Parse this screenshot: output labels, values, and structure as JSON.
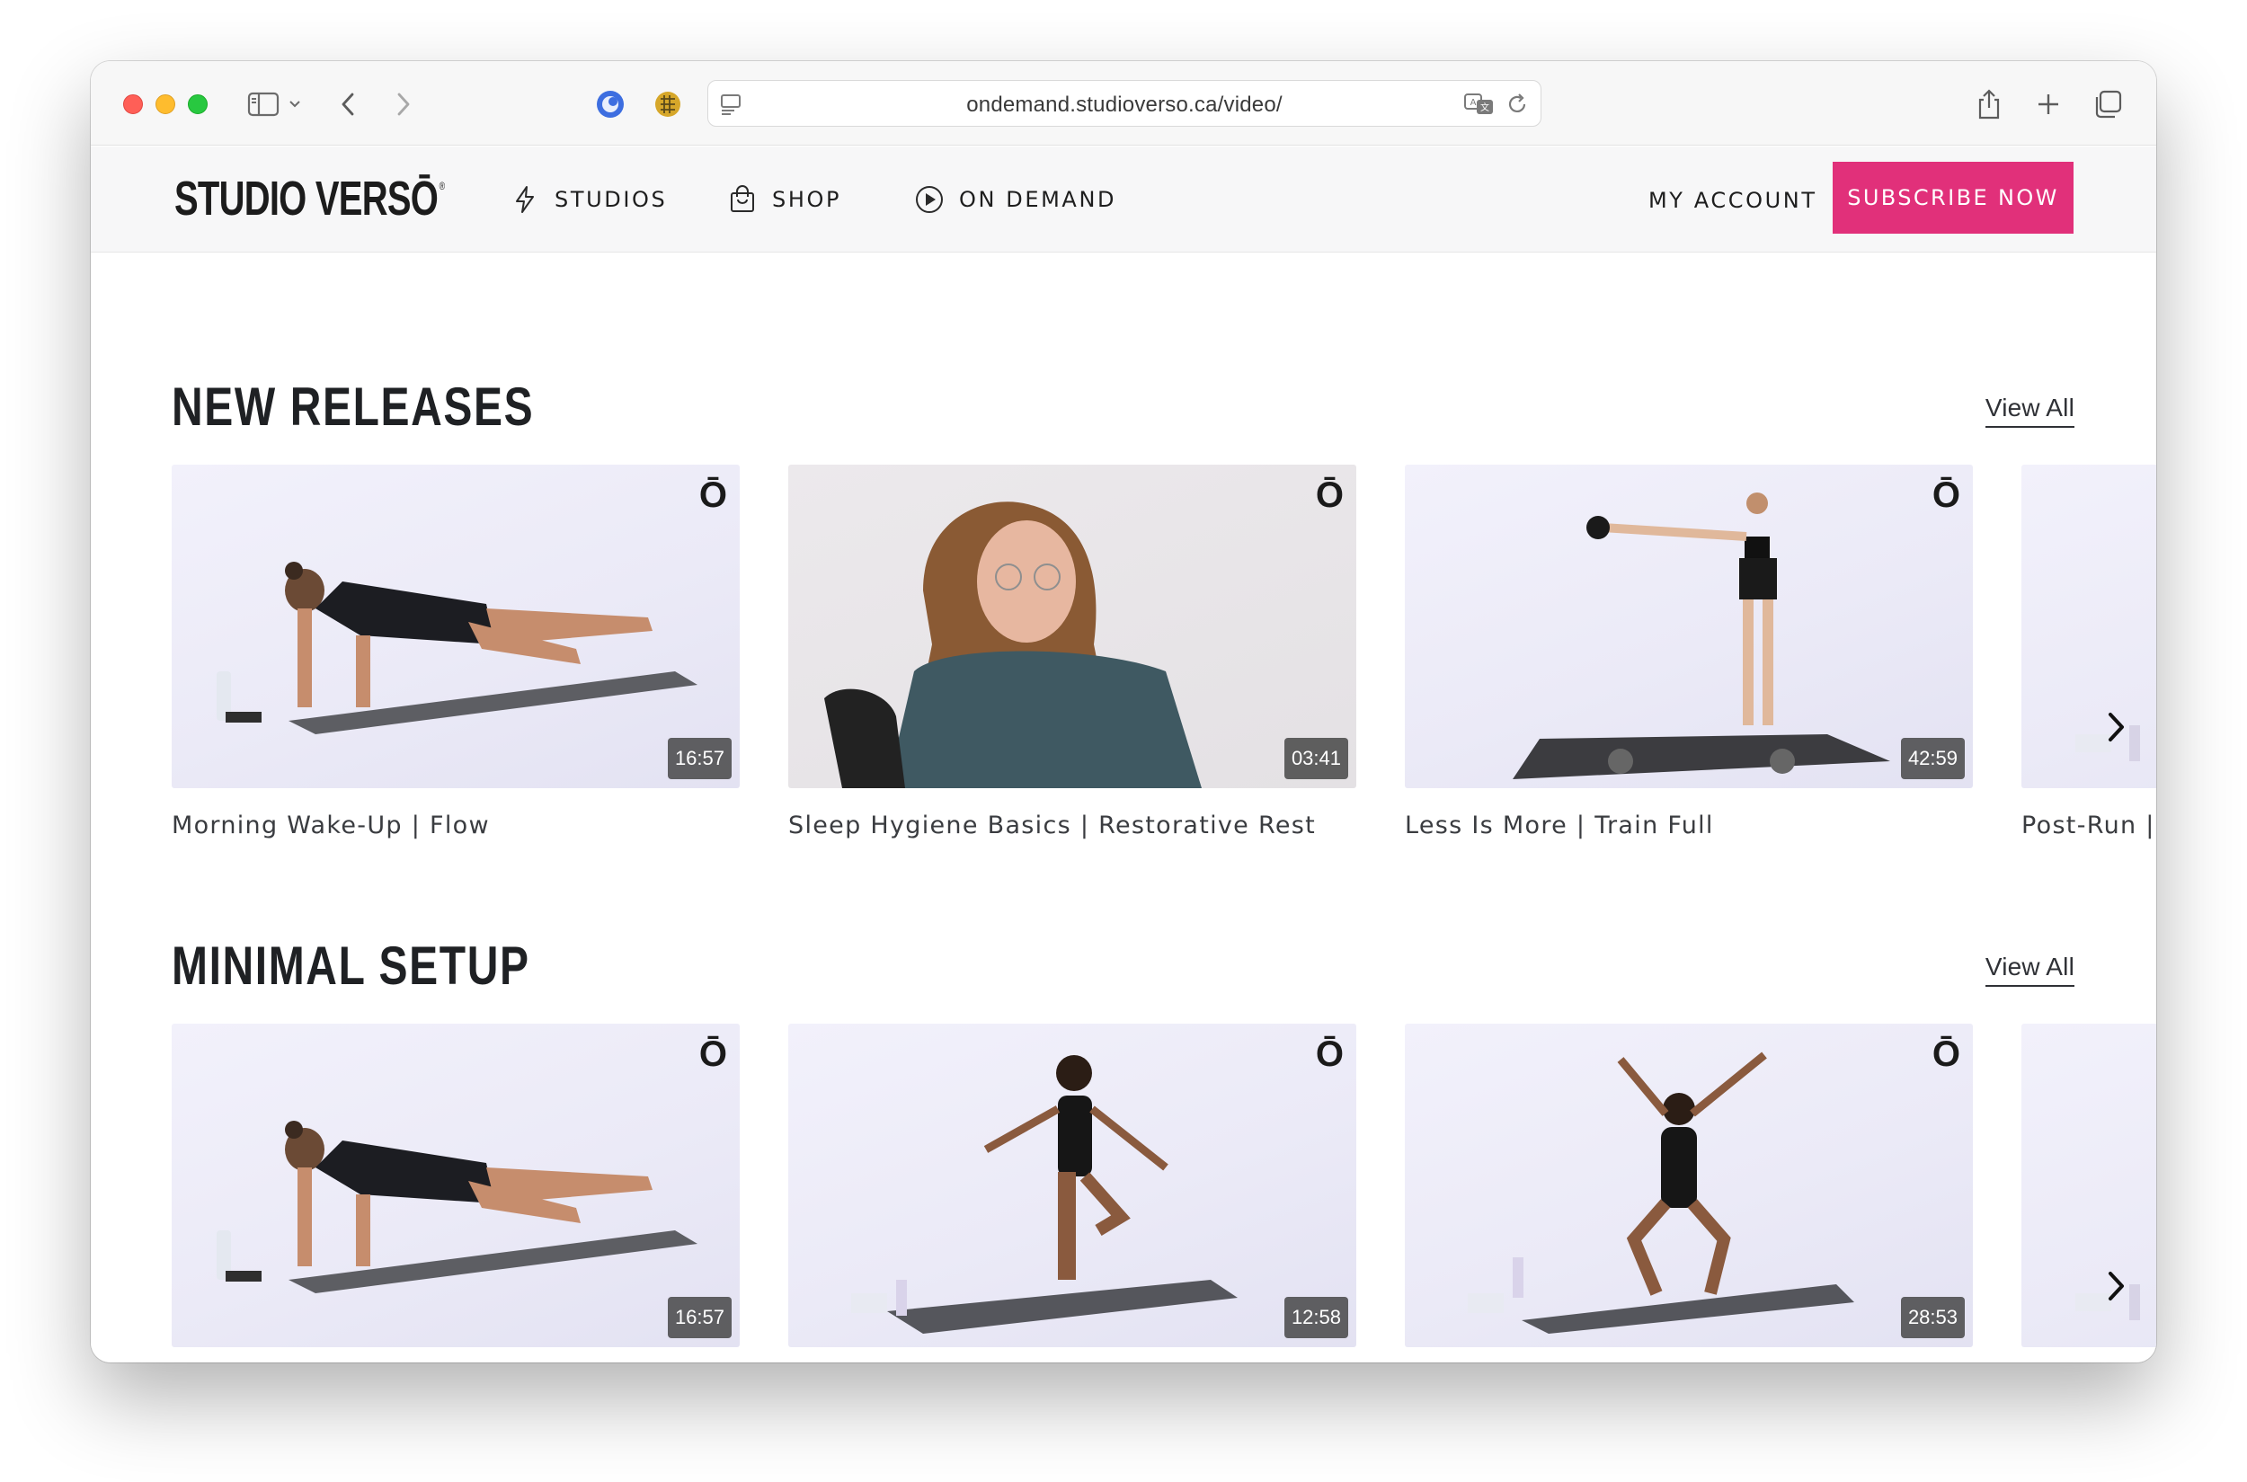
{
  "browser": {
    "url": "ondemand.studioverso.ca/video/"
  },
  "site": {
    "logo": "STUDIO VERSŌ",
    "logo_mark": "®",
    "nav": [
      {
        "label": "STUDIOS",
        "icon": "lightning-icon"
      },
      {
        "label": "SHOP",
        "icon": "shopping-bag-icon"
      },
      {
        "label": "ON DEMAND",
        "icon": "play-circle-icon"
      }
    ],
    "account_label": "MY ACCOUNT",
    "subscribe_label": "SUBSCRIBE NOW",
    "accent_color": "#e1307a"
  },
  "sections": [
    {
      "title": "NEW RELEASES",
      "view_all": "View All",
      "videos": [
        {
          "title": "Morning Wake-Up | Flow",
          "duration": "16:57",
          "brand": "Ō"
        },
        {
          "title": "Sleep Hygiene Basics | Restorative Rest",
          "duration": "03:41",
          "brand": "Ō"
        },
        {
          "title": "Less Is More | Train Full",
          "duration": "42:59",
          "brand": "Ō"
        },
        {
          "title": "Post-Run | C",
          "duration": "",
          "brand": ""
        }
      ]
    },
    {
      "title": "MINIMAL SETUP",
      "view_all": "View All",
      "videos": [
        {
          "title": "",
          "duration": "16:57",
          "brand": "Ō"
        },
        {
          "title": "",
          "duration": "12:58",
          "brand": "Ō"
        },
        {
          "title": "",
          "duration": "28:53",
          "brand": "Ō"
        },
        {
          "title": "",
          "duration": "",
          "brand": ""
        }
      ]
    }
  ]
}
